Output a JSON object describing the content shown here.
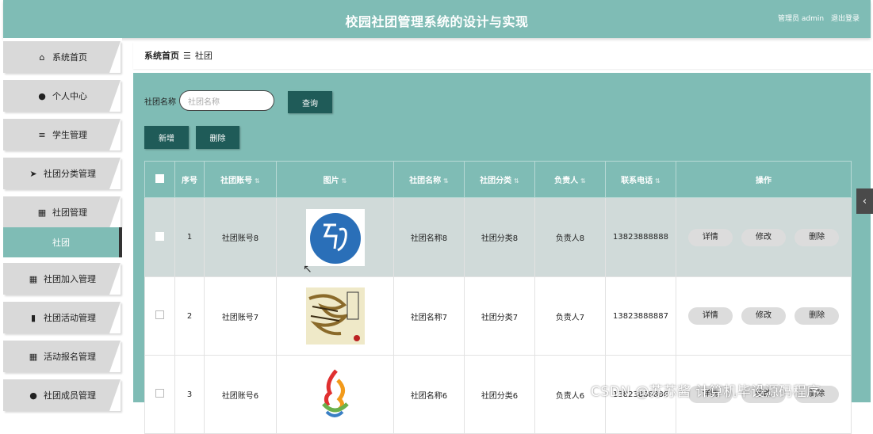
{
  "header": {
    "title": "校园社团管理系统的设计与实现",
    "role": "管理员 admin",
    "logout": "退出登录"
  },
  "sidebar": {
    "items": [
      {
        "label": "系统首页",
        "icon": "home-icon"
      },
      {
        "label": "个人中心",
        "icon": "user-icon"
      },
      {
        "label": "学生管理",
        "icon": "sliders-icon"
      },
      {
        "label": "社团分类管理",
        "icon": "send-icon"
      },
      {
        "label": "社团管理",
        "icon": "grid-icon"
      },
      {
        "label": "社团加入管理",
        "icon": "grid-icon"
      },
      {
        "label": "社团活动管理",
        "icon": "bar-chart-icon"
      },
      {
        "label": "活动报名管理",
        "icon": "grid-icon"
      },
      {
        "label": "社团成员管理",
        "icon": "pin-icon"
      }
    ],
    "active_sub": "社团"
  },
  "breadcrumb": {
    "home": "系统首页",
    "sep": "☰",
    "current": "社团"
  },
  "search": {
    "label": "社团名称",
    "placeholder": "社团名称",
    "button": "查询"
  },
  "actions": {
    "add": "新增",
    "delete": "删除"
  },
  "table": {
    "headers": [
      "序号",
      "社团账号",
      "图片",
      "社团名称",
      "社团分类",
      "负责人",
      "联系电话",
      "操作"
    ],
    "row_actions": {
      "detail": "详情",
      "edit": "修改",
      "delete": "删除"
    },
    "rows": [
      {
        "index": "1",
        "account": "社团账号8",
        "name": "社团名称8",
        "category": "社团分类8",
        "leader": "负责人8",
        "phone": "13823888888"
      },
      {
        "index": "2",
        "account": "社团账号7",
        "name": "社团名称7",
        "category": "社团分类7",
        "leader": "负责人7",
        "phone": "13823888887"
      },
      {
        "index": "3",
        "account": "社团账号6",
        "name": "社团名称6",
        "category": "社团分类6",
        "leader": "负责人6",
        "phone": "13823888886"
      }
    ]
  },
  "side_tab": "‹",
  "watermark": "CSDN @苏苏酱 计算机毕设源码程序"
}
